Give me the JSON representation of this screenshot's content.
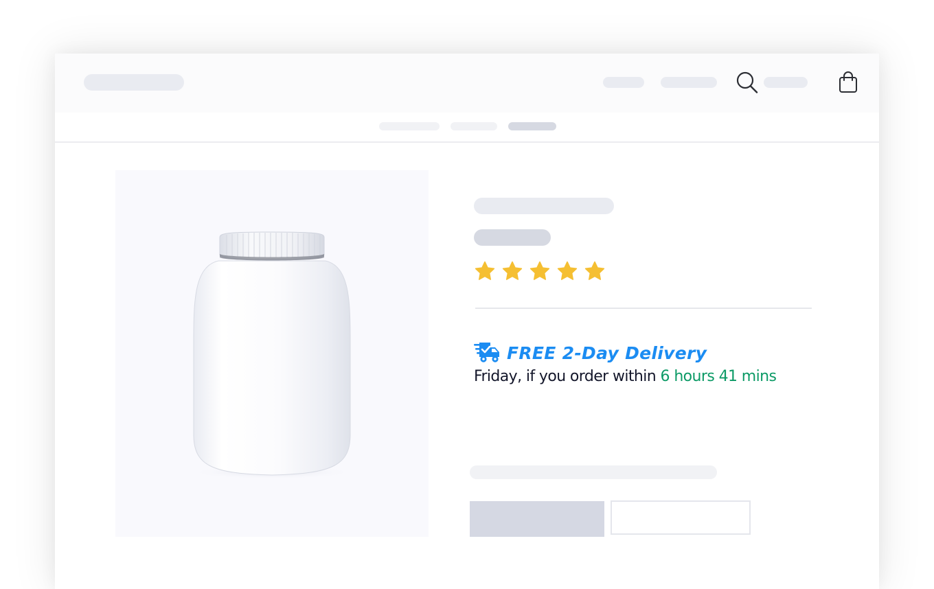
{
  "header": {
    "icons": [
      "search-icon",
      "shopping-bag-icon"
    ]
  },
  "product": {
    "image": "supplement-jar",
    "rating_stars": 5,
    "rating_max": 5
  },
  "delivery": {
    "icon": "delivery-truck-icon",
    "title": "FREE 2-Day Delivery",
    "line": "Friday, if you order within",
    "time_left": "6 hours 41 mins"
  },
  "colors": {
    "accent_blue": "#1b8cf2",
    "countdown_green": "#0c9a66",
    "star_gold": "#f5bf32",
    "placeholder_light": "#e9ebf1",
    "placeholder_medium": "#d6d9e2"
  }
}
